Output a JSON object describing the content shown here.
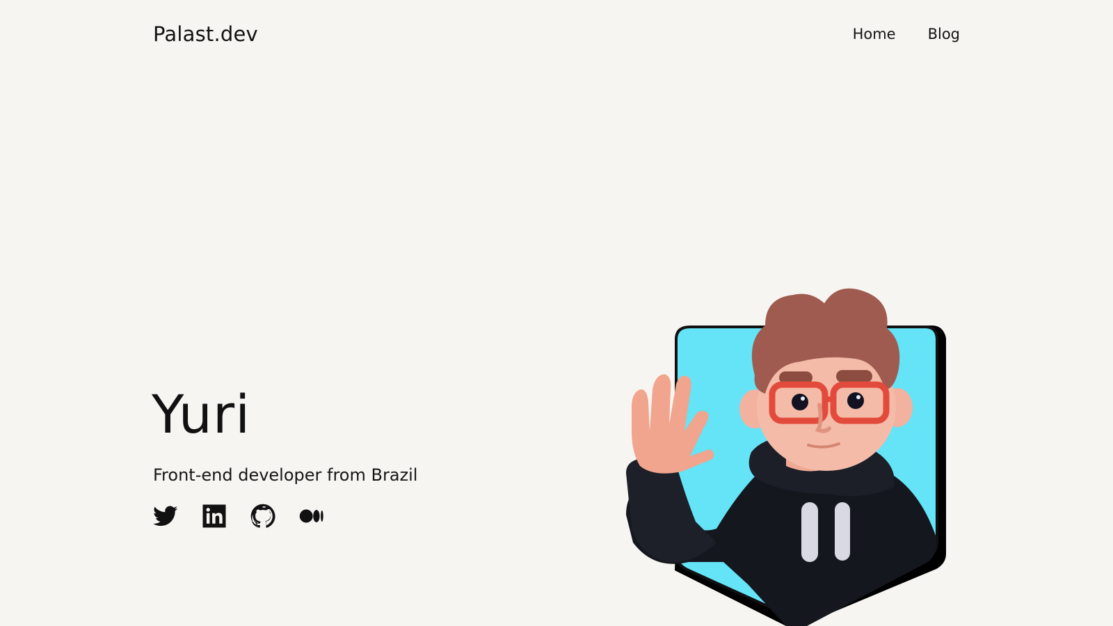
{
  "header": {
    "logo": "Palast.dev",
    "nav": [
      {
        "label": "Home"
      },
      {
        "label": "Blog"
      }
    ]
  },
  "hero": {
    "name": "Yuri",
    "subtitle": "Front-end developer from Brazil"
  },
  "socials": [
    {
      "icon": "twitter-icon"
    },
    {
      "icon": "linkedin-icon"
    },
    {
      "icon": "github-icon"
    },
    {
      "icon": "medium-icon"
    }
  ],
  "colors": {
    "background": "#f7f5f2",
    "text": "#111111",
    "avatar_backdrop": "#65e3f7"
  }
}
